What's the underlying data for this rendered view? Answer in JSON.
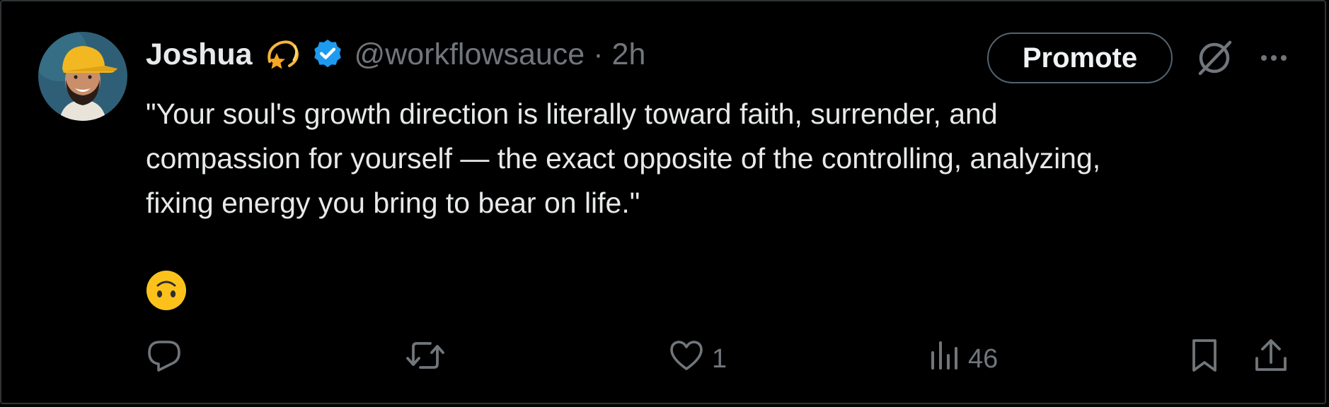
{
  "tweet": {
    "author_name": "Joshua",
    "author_emoji": "dizzy-star",
    "verified": true,
    "handle": "@workflowsauce",
    "separator": "·",
    "time": "2h",
    "text_lines": [
      "\"Your soul's growth direction is literally toward faith, surrender, and",
      "compassion for yourself — the exact opposite of the controlling, analyzing,",
      "fixing energy you bring to bear on life.\""
    ],
    "emoji": "upside-down-face"
  },
  "header": {
    "promote_label": "Promote"
  },
  "actions": {
    "reply_count": "",
    "repost_count": "",
    "like_count": "1",
    "views_count": "46"
  },
  "colors": {
    "background": "#000000",
    "text_primary": "#e7e9ea",
    "text_secondary": "#71767b",
    "verified_blue": "#1d9bf0",
    "border": "#536471"
  }
}
